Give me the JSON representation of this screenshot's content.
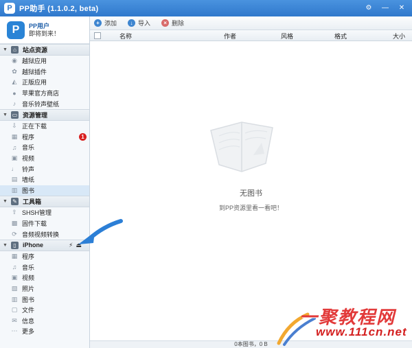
{
  "window": {
    "logo": "P",
    "title": "PP助手 (1.1.0.2, beta)",
    "controls": [
      "⚙",
      "—",
      "✕"
    ]
  },
  "user": {
    "avatar": "P",
    "name": "PP用户",
    "subtitle": "即将到来！"
  },
  "sidebar": {
    "groups": [
      {
        "label": "站点资源",
        "icon": "home-icon",
        "items": [
          {
            "label": "越狱应用",
            "icon": "app-icon"
          },
          {
            "label": "越狱插件",
            "icon": "plugin-icon"
          },
          {
            "label": "正版应用",
            "icon": "appstore-icon"
          },
          {
            "label": "苹果官方商店",
            "icon": "apple-icon"
          },
          {
            "label": "音乐铃声壁纸",
            "icon": "music-icon"
          }
        ]
      },
      {
        "label": "资源管理",
        "icon": "monitor-icon",
        "items": [
          {
            "label": "正在下载",
            "icon": "download-icon"
          },
          {
            "label": "程序",
            "icon": "program-icon",
            "badge": "1"
          },
          {
            "label": "音乐",
            "icon": "music-icon"
          },
          {
            "label": "视频",
            "icon": "video-icon"
          },
          {
            "label": "铃声",
            "icon": "ringtone-icon"
          },
          {
            "label": "墙纸",
            "icon": "wallpaper-icon"
          },
          {
            "label": "图书",
            "icon": "book-icon",
            "active": true
          }
        ]
      },
      {
        "label": "工具箱",
        "icon": "toolbox-icon",
        "items": [
          {
            "label": "SHSH管理",
            "icon": "shsh-icon"
          },
          {
            "label": "固件下载",
            "icon": "firmware-icon"
          },
          {
            "label": "音频视频转换",
            "icon": "convert-icon"
          }
        ]
      },
      {
        "label": "iPhone",
        "icon": "iphone-icon",
        "items": [
          {
            "label": "程序",
            "icon": "program-icon"
          },
          {
            "label": "音乐",
            "icon": "music-icon"
          },
          {
            "label": "视频",
            "icon": "video-icon"
          },
          {
            "label": "照片",
            "icon": "photo-icon"
          },
          {
            "label": "图书",
            "icon": "book-icon"
          },
          {
            "label": "文件",
            "icon": "file-icon"
          },
          {
            "label": "信息",
            "icon": "message-icon"
          },
          {
            "label": "更多",
            "icon": "more-icon"
          }
        ]
      }
    ]
  },
  "toolbar": {
    "add_label": "添加",
    "import_label": "导入",
    "delete_label": "删除"
  },
  "columns": {
    "name": "名称",
    "author": "作者",
    "style": "风格",
    "format": "格式",
    "size": "大小"
  },
  "empty": {
    "title": "无图书",
    "subtitle": "到PP资源里看一看吧！"
  },
  "status": {
    "text": "0本图书，0 B"
  },
  "watermark": {
    "line1": "一聚教程网",
    "line2": "www.111cn.net"
  },
  "colors": {
    "titlebar": "#2f78cc",
    "accent": "#3f86d0",
    "badge": "#d82020",
    "arrow": "#2c7fd6",
    "watermark": "#e23a3a"
  }
}
